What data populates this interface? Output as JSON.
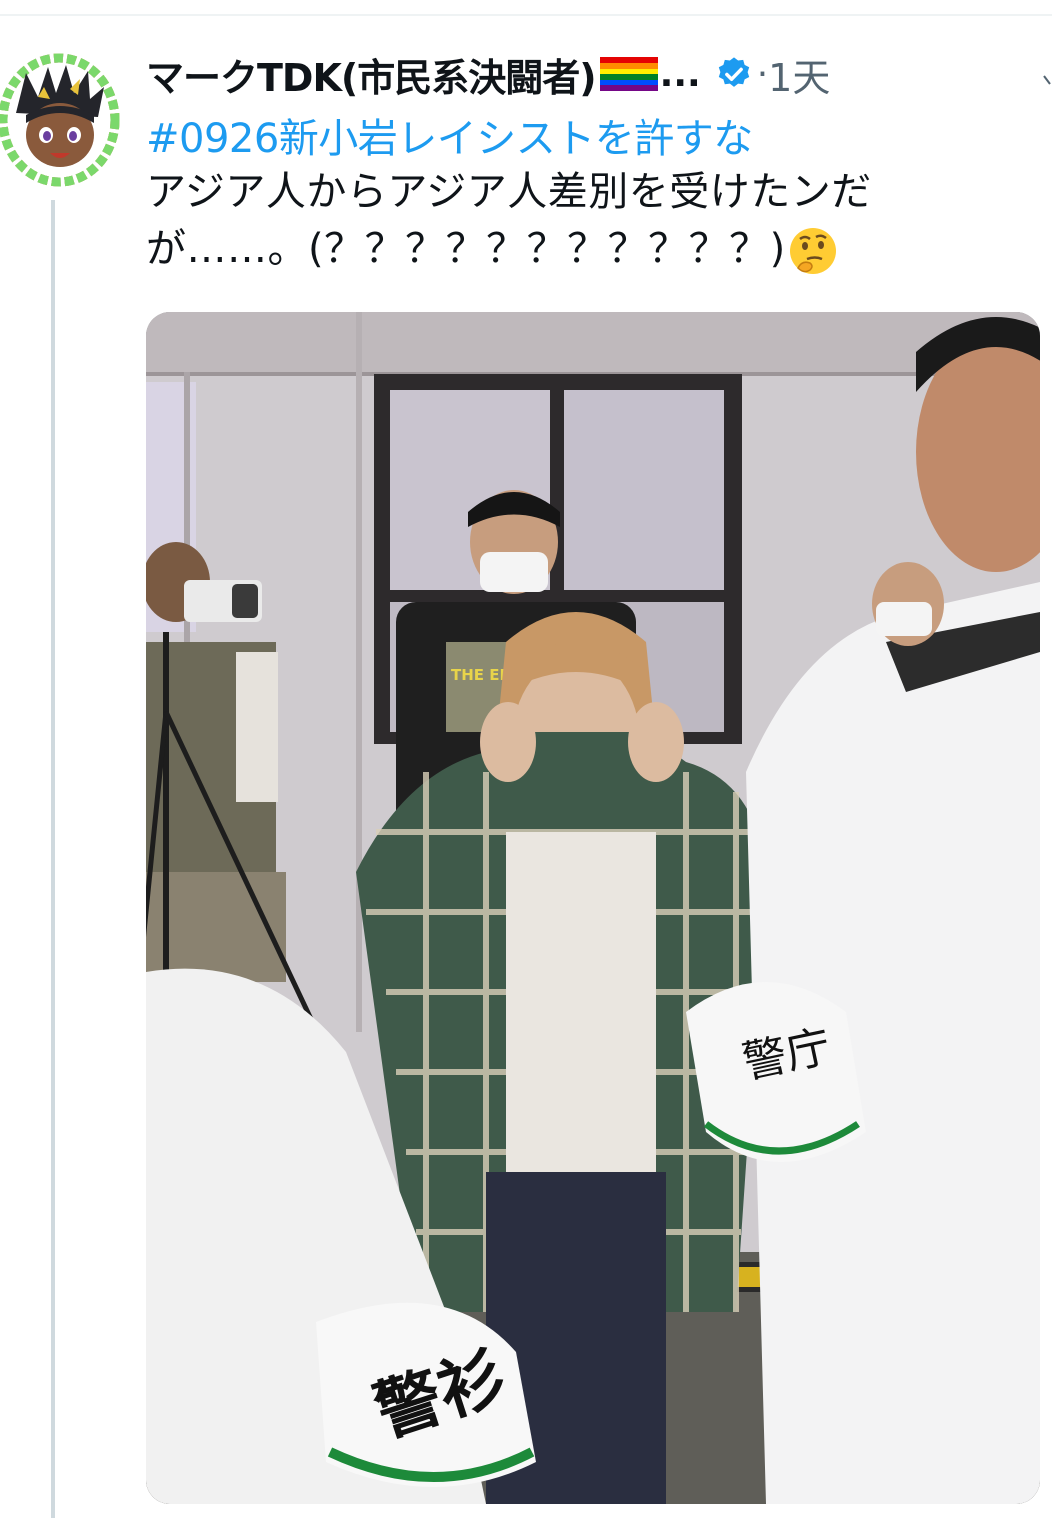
{
  "tweet": {
    "author_name": "マークTDK(市民系決闘者)",
    "truncation": "...",
    "separator": "·",
    "timestamp": "1天",
    "hashtag": "#0926新小岩レイシストを許すな",
    "text_line1": "アジア人からアジア人差別を受けたンだ",
    "text_line2": "が……。(？？？？？？？？？？？)",
    "emoji": "thinking-face-icon",
    "photo": {
      "armband_left_text": "警衫",
      "armband_right_text": "警庁",
      "tshirt_text": "THE ERCO"
    }
  },
  "icons": {
    "flag": "rainbow-flag-icon",
    "verified": "verified-badge-icon",
    "more": "chevron-icon"
  },
  "colors": {
    "text_primary": "#0f1419",
    "text_secondary": "#536471",
    "link": "#1d9bf0",
    "verified": "#1d9bf0",
    "thread_line": "#cfd9de"
  }
}
